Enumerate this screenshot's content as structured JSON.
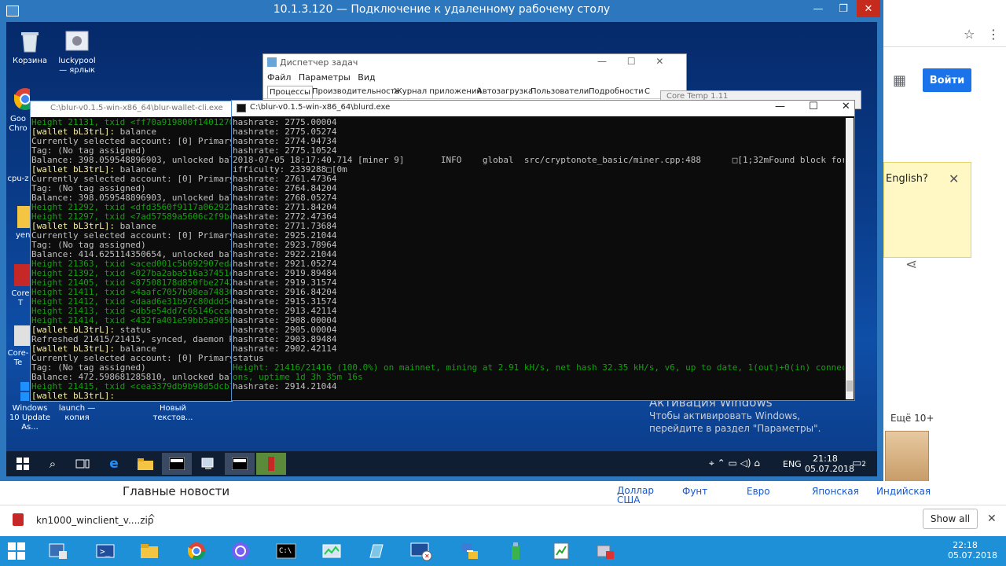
{
  "rdp": {
    "title": "10.1.3.120 — Подключение к удаленному рабочему столу",
    "min": "—",
    "restore": "❐",
    "close": "✕"
  },
  "desktop_icons": [
    {
      "label": "Корзина"
    },
    {
      "label": "luckypool — ярлык"
    },
    {
      "label": "Goo Chro"
    },
    {
      "label": "cpu-z"
    },
    {
      "label": "yen"
    },
    {
      "label": "Core T"
    },
    {
      "label": "Core-Te"
    },
    {
      "label": "Windows 10 Update As..."
    },
    {
      "label": "launch — копия"
    },
    {
      "label": "Новый текстов..."
    }
  ],
  "task_manager": {
    "title": "Диспетчер задач",
    "menu": [
      "Файл",
      "Параметры",
      "Вид"
    ],
    "tabs": [
      "Процессы",
      "Производительность",
      "Журнал приложений",
      "Автозагрузка",
      "Пользователи",
      "Подробности",
      "С"
    ]
  },
  "core_temp": {
    "title": "Core Temp 1.11"
  },
  "wallet_window": {
    "title": "C:\\blur-v0.1.5-win-x86_64\\blur-wallet-cli.exe",
    "lines": [
      {
        "c": "g",
        "t": "Height 21131, txid <ff70a919800f1401270"
      },
      {
        "c": "y",
        "t": "[wallet bL3trL]: "
      },
      {
        "c": "w",
        "t": "Currently selected account: [0] Primary"
      },
      {
        "c": "w",
        "t": "Tag: (No tag assigned)"
      },
      {
        "c": "w",
        "t": "Balance: 398.059548896903, unlocked bal"
      },
      {
        "c": "y",
        "t": "[wallet bL3trL]: "
      },
      {
        "c": "w",
        "t": "Currently selected account: [0] Primary"
      },
      {
        "c": "w",
        "t": "Tag: (No tag assigned)"
      },
      {
        "c": "w",
        "t": "Balance: 398.059548896903, unlocked bal"
      },
      {
        "c": "g",
        "t": "Height 21292, txid <dfd3560f9117a062922"
      },
      {
        "c": "g",
        "t": "Height 21297, txid <7ad57589a5606c2f9bc"
      },
      {
        "c": "y",
        "t": "[wallet bL3trL]: "
      },
      {
        "c": "w",
        "t": "Currently selected account: [0] Primary"
      },
      {
        "c": "w",
        "t": "Tag: (No tag assigned)"
      },
      {
        "c": "w",
        "t": "Balance: 414.625114350654, unlocked bal"
      },
      {
        "c": "g",
        "t": "Height 21363, txid <aced001c5b692907eda"
      },
      {
        "c": "g",
        "t": "Height 21392, txid <027ba2aba516a37451e"
      },
      {
        "c": "g",
        "t": "Height 21405, txid <87508178d850fbe2742"
      },
      {
        "c": "g",
        "t": "Height 21411, txid <4aafc7057b98ea74836"
      },
      {
        "c": "g",
        "t": "Height 21412, txid <daad6e31b97c80ddd54"
      },
      {
        "c": "g",
        "t": "Height 21413, txid <db5e54dd7c65146ccad"
      },
      {
        "c": "g",
        "t": "Height 21414, txid <432fa401e59bb5a905b"
      },
      {
        "c": "y",
        "t": "[wallet bL3trL]: "
      },
      {
        "c": "w",
        "t": "Refreshed 21415/21415, synced, daemon R"
      },
      {
        "c": "y",
        "t": "[wallet bL3trL]: "
      },
      {
        "c": "w",
        "t": "Currently selected account: [0] Primary"
      },
      {
        "c": "w",
        "t": "Tag: (No tag assigned)"
      },
      {
        "c": "w",
        "t": "Balance: 472.598681285810, unlocked bal"
      },
      {
        "c": "g",
        "t": "Height 21415, txid <cea3379db9b98d5dcb7"
      },
      {
        "c": "y",
        "t": "[wallet bL3trL]: "
      }
    ],
    "cmds": [
      "balance",
      "balance",
      "balance",
      "status",
      "balance"
    ]
  },
  "blurd_window": {
    "title": "C:\\blur-v0.1.5-win-x86_64\\blurd.exe",
    "ctl": "—  ☐  ✕",
    "lines": [
      {
        "c": "w",
        "t": "hashrate: 2775.00004"
      },
      {
        "c": "w",
        "t": "hashrate: 2775.05274"
      },
      {
        "c": "w",
        "t": "hashrate: 2774.94734"
      },
      {
        "c": "w",
        "t": "hashrate: 2775.10524"
      },
      {
        "c": "w",
        "t": "2018-07-05 18:17:40.714 [miner 9]       INFO    global  src/cryptonote_basic/miner.cpp:488      □[1;32mFound block for d"
      },
      {
        "c": "w",
        "t": "ifficulty: 2339288□[0m"
      },
      {
        "c": "w",
        "t": "hashrate: 2761.47364"
      },
      {
        "c": "w",
        "t": "hashrate: 2764.84204"
      },
      {
        "c": "w",
        "t": "hashrate: 2768.05274"
      },
      {
        "c": "w",
        "t": "hashrate: 2771.84204"
      },
      {
        "c": "w",
        "t": "hashrate: 2772.47364"
      },
      {
        "c": "w",
        "t": "hashrate: 2771.73684"
      },
      {
        "c": "w",
        "t": "hashrate: 2925.21044"
      },
      {
        "c": "w",
        "t": "hashrate: 2923.78964"
      },
      {
        "c": "w",
        "t": "hashrate: 2922.21044"
      },
      {
        "c": "w",
        "t": "hashrate: 2921.05274"
      },
      {
        "c": "w",
        "t": "hashrate: 2919.89484"
      },
      {
        "c": "w",
        "t": "hashrate: 2919.31574"
      },
      {
        "c": "w",
        "t": "hashrate: 2916.84204"
      },
      {
        "c": "w",
        "t": "hashrate: 2915.31574"
      },
      {
        "c": "w",
        "t": "hashrate: 2913.42114"
      },
      {
        "c": "w",
        "t": "hashrate: 2908.00004"
      },
      {
        "c": "w",
        "t": "hashrate: 2905.00004"
      },
      {
        "c": "w",
        "t": "hashrate: 2903.89484"
      },
      {
        "c": "w",
        "t": "hashrate: 2902.42114"
      },
      {
        "c": "w",
        "t": "status"
      },
      {
        "c": "g",
        "t": "Height: 21416/21416 (100.0%) on mainnet, mining at 2.91 kH/s, net hash 32.35 kH/s, v6, up to date, 1(out)+0(in) connecti"
      },
      {
        "c": "g",
        "t": "ons, uptime 1d 3h 35m 16s"
      },
      {
        "c": "w",
        "t": "hashrate: 2914.21044"
      },
      {
        "c": "w",
        "t": "_"
      }
    ]
  },
  "watermark": {
    "title": "Активация Windows",
    "body": "Чтобы активировать Windows, перейдите в раздел \"Параметры\"."
  },
  "remote_taskbar": {
    "lang": "ENG",
    "time": "21:18",
    "date": "05.07.2018",
    "notif": "2"
  },
  "browser": {
    "login": "Войти",
    "translate_q": "English?",
    "more": "Ещё 10+",
    "news_title": "Главные новости",
    "currencies": [
      "Доллар США",
      "Фунт",
      "Евро",
      "Японская",
      "Индийская"
    ]
  },
  "download": {
    "file": "kn1000_winclient_v....zip",
    "show_all": "Show all"
  },
  "host_taskbar": {
    "time": "22:18",
    "date": "05.07.2018"
  },
  "colors": {
    "rdp_frame": "#2c77bd",
    "host_taskbar": "#1e90d8",
    "console_green": "#13a10e",
    "console_yellow": "#f9f1a5"
  }
}
